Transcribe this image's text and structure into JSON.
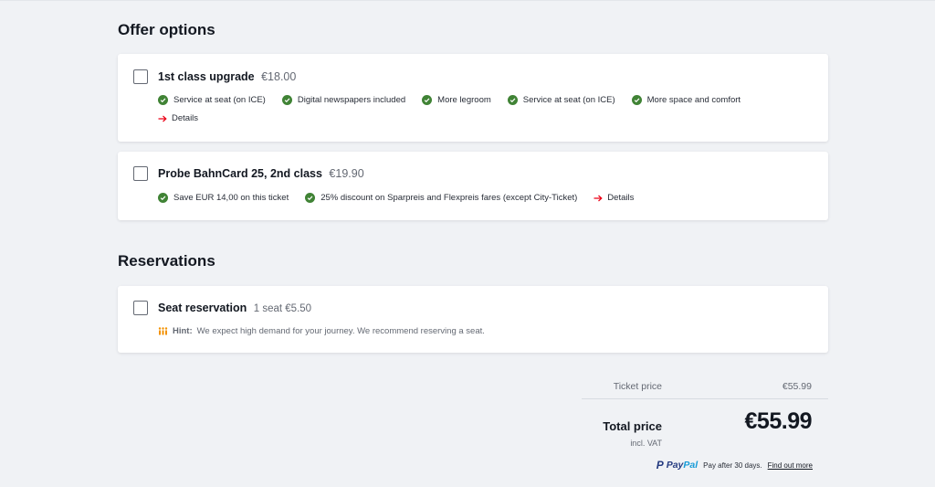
{
  "offers": {
    "title": "Offer options",
    "upgrade": {
      "title": "1st class upgrade",
      "price": "€18.00",
      "features": [
        "Service at seat (on ICE)",
        "Digital newspapers included",
        "More legroom",
        "Service at seat (on ICE)",
        "More space and comfort"
      ],
      "details": "Details"
    },
    "bahncard": {
      "title": "Probe BahnCard 25, 2nd class",
      "price": "€19.90",
      "features": [
        "Save EUR 14,00 on this ticket",
        "25% discount on Sparpreis and Flexpreis fares (except City-Ticket)"
      ],
      "details": "Details"
    }
  },
  "reservations": {
    "title": "Reservations",
    "seat": {
      "title": "Seat reservation",
      "price": "1 seat €5.50",
      "hint_label": "Hint:",
      "hint_text": "We expect high demand for your journey. We recommend reserving a seat."
    }
  },
  "summary": {
    "ticket_label": "Ticket price",
    "ticket_value": "€55.99",
    "total_label": "Total price",
    "vat_label": "incl. VAT",
    "total_value": "€55.99",
    "paypal_pay": "Pay",
    "paypal_pal": "Pal",
    "paypal_text": "Pay after 30 days.",
    "paypal_link": "Find out more"
  },
  "colors": {
    "check_green": "#408335",
    "arrow_red": "#ec0016",
    "hint_orange": "#f39200",
    "paypal_dark": "#253b80",
    "paypal_light": "#179bd7"
  }
}
